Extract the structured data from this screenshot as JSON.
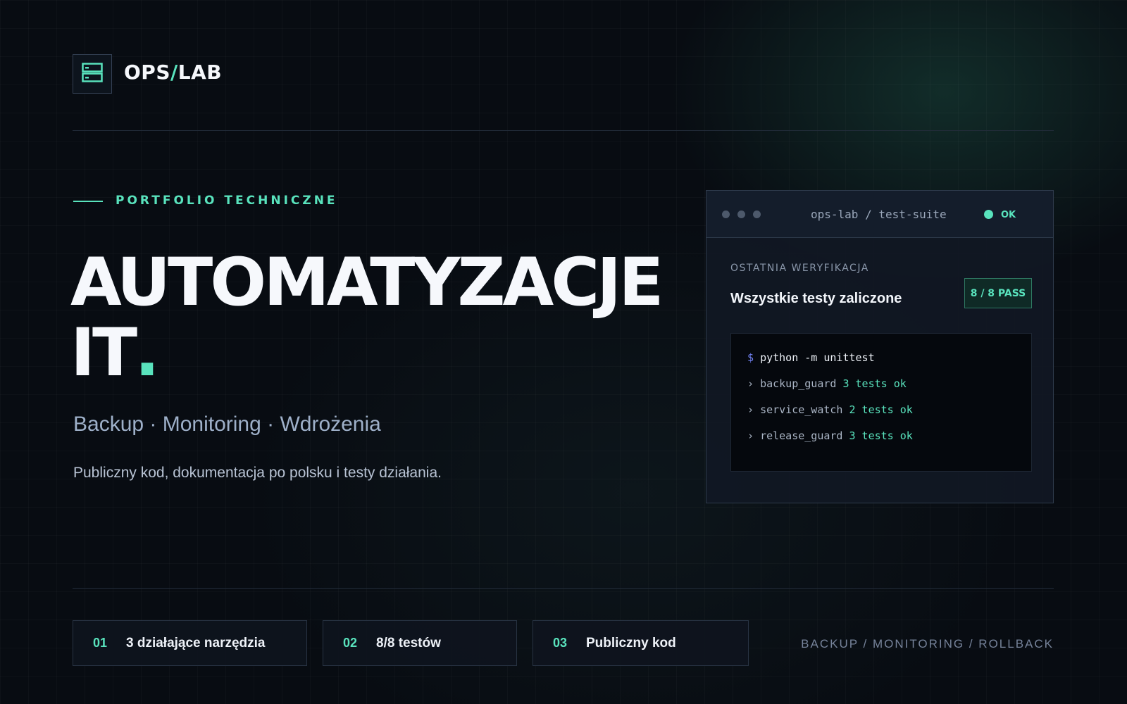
{
  "brand": {
    "name_prefix": "OPS",
    "name_slash": "/",
    "name_suffix": "LAB",
    "logo_icon": "server-stack-icon"
  },
  "hero": {
    "kicker": "PORTFOLIO TECHNICZNE",
    "headline_line1": "AUTOMATYZACJE",
    "headline_line2": "IT",
    "headline_dot": ".",
    "subline": "Backup · Monitoring · Wdrożenia",
    "description": "Publiczny kod, dokumentacja po polsku i testy działania."
  },
  "card": {
    "title": "ops-lab / test-suite",
    "status": "OK",
    "label": "OSTATNIA WERYFIKACJA",
    "heading": "Wszystkie testy zaliczone",
    "badge": "8 / 8 PASS",
    "terminal": {
      "prompt": "$",
      "command": "python -m unittest",
      "results": [
        {
          "marker": "›",
          "module": "backup_guard",
          "result": "3 tests ok"
        },
        {
          "marker": "›",
          "module": "service_watch",
          "result": "2 tests ok"
        },
        {
          "marker": "›",
          "module": "release_guard",
          "result": "3 tests ok"
        }
      ]
    }
  },
  "stats": [
    {
      "num": "01",
      "label": "3 działające narzędzia"
    },
    {
      "num": "02",
      "label": "8/8 testów"
    },
    {
      "num": "03",
      "label": "Publiczny kod"
    }
  ],
  "footer_tags": "BACKUP / MONITORING / ROLLBACK",
  "colors": {
    "accent": "#59e3bd",
    "background": "#080c12",
    "prompt": "#6f7fef"
  }
}
